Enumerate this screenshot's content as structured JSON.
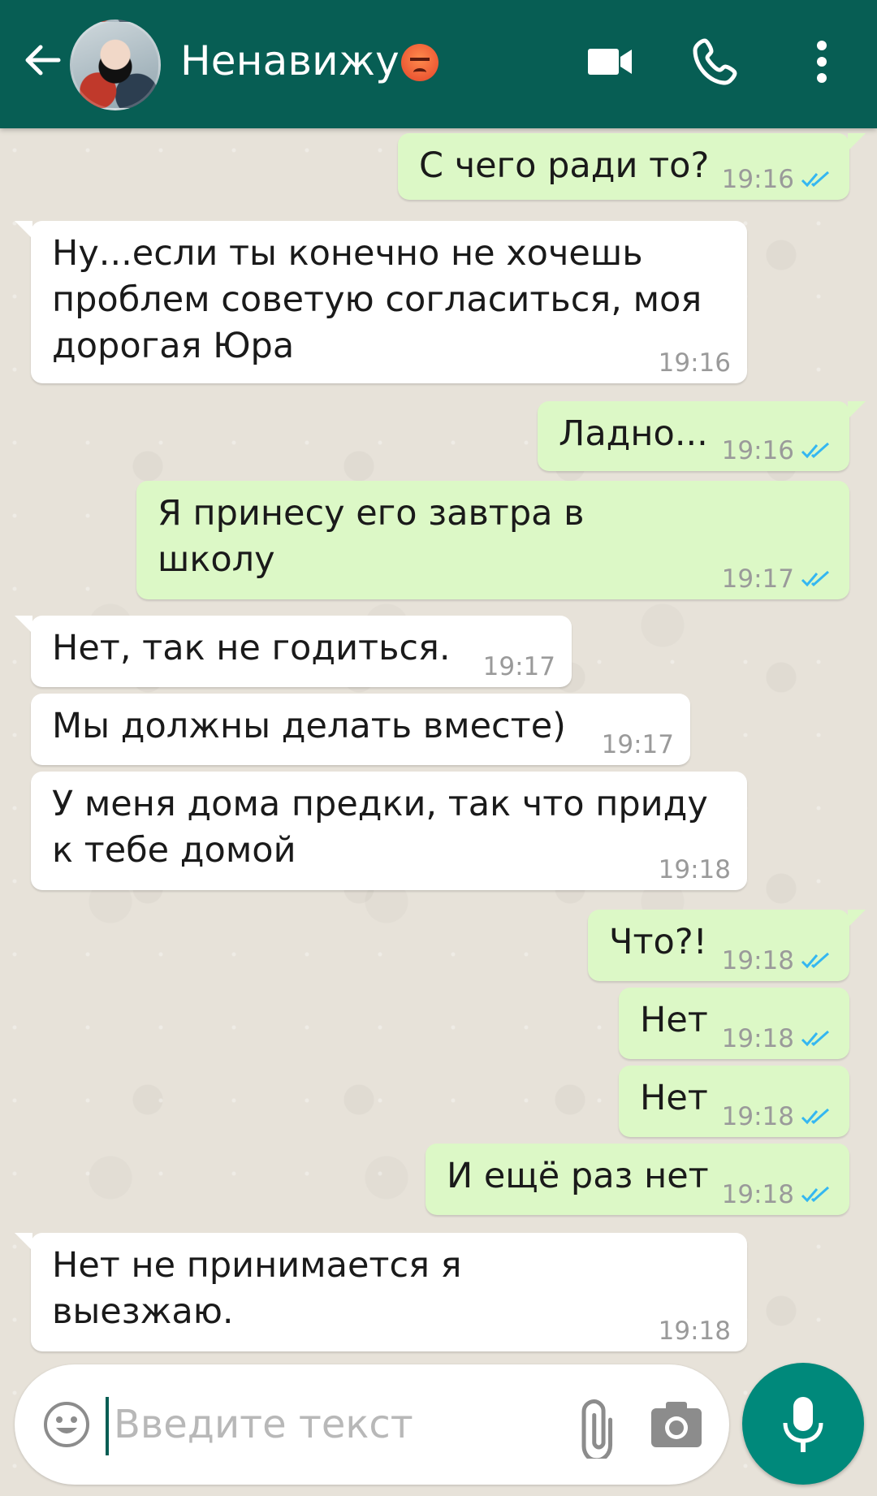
{
  "header": {
    "contact_name": "Ненавижу",
    "status_emoji": "angry-face",
    "bg_color": "#075e54",
    "icons": [
      "back-arrow-icon",
      "video-call-icon",
      "phone-icon",
      "more-vert-icon"
    ]
  },
  "messages": [
    {
      "dir": "out",
      "text": "С чего ради то?",
      "time": "19:16",
      "read": true
    },
    {
      "dir": "in",
      "text": "Ну...если ты конечно не хочешь проблем советую согласиться, моя дорогая Юра",
      "time": "19:16"
    },
    {
      "dir": "out",
      "text": "Ладно...",
      "time": "19:16",
      "read": true
    },
    {
      "dir": "out",
      "text": "Я принесу его завтра в школу",
      "time": "19:17",
      "read": true
    },
    {
      "dir": "in",
      "text": "Нет, так не годиться.",
      "time": "19:17"
    },
    {
      "dir": "in",
      "text": "Мы должны делать вместе)",
      "time": "19:17"
    },
    {
      "dir": "in",
      "text": "У меня дома предки, так что приду к тебе домой",
      "time": "19:18"
    },
    {
      "dir": "out",
      "text": "Что?!",
      "time": "19:18",
      "read": true
    },
    {
      "dir": "out",
      "text": "Нет",
      "time": "19:18",
      "read": true
    },
    {
      "dir": "out",
      "text": "Нет",
      "time": "19:18",
      "read": true
    },
    {
      "dir": "out",
      "text": "И ещё раз нет",
      "time": "19:18",
      "read": true
    },
    {
      "dir": "in",
      "text": "Нет не принимается я выезжаю.",
      "time": "19:18"
    }
  ],
  "input": {
    "placeholder": "Введите текст"
  },
  "colors": {
    "incoming": "#ffffff",
    "outgoing": "#dcf8c6",
    "read_ticks": "#34b7f1",
    "accent": "#00897b"
  }
}
